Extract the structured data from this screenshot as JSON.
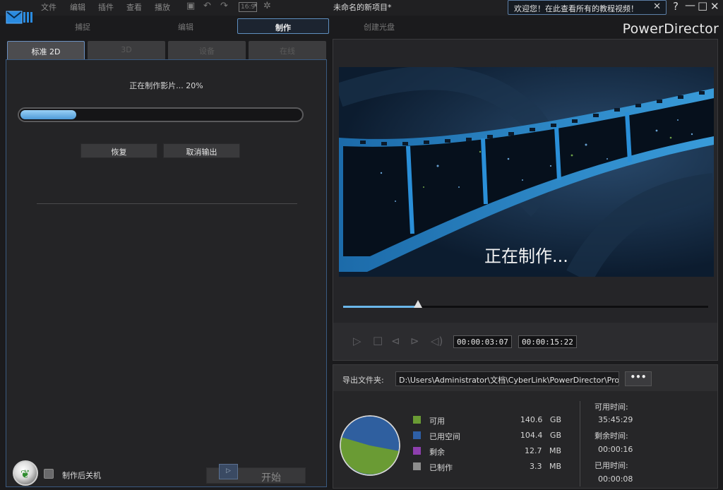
{
  "menu": {
    "file": "文件",
    "edit": "编辑",
    "plugins": "插件",
    "view": "查看",
    "playback": "播放"
  },
  "toolbar": {
    "aspect": "16:9"
  },
  "window_title": "未命名的新项目*",
  "welcome_tip": "欢迎您！在此查看所有的教程视频！",
  "window_controls": {
    "help": "?",
    "minimize": "—",
    "maximize": "□",
    "close": "✕"
  },
  "mode_tabs": {
    "capture": "捕捉",
    "edit": "编辑",
    "produce": "制作",
    "create_disc": "创建光盘"
  },
  "brand": "PowerDirector",
  "left_tabs": {
    "standard_2d": "标准 2D",
    "three_d": "3D",
    "device": "设备",
    "online": "在线"
  },
  "production": {
    "status": "正在制作影片... 20%",
    "progress_fraction": 0.2,
    "resume_label": "恢复",
    "cancel_label": "取消输出"
  },
  "footer": {
    "shutdown_label": "制作后关机",
    "start_label": "开始"
  },
  "preview": {
    "caption": "正在制作...",
    "seek_fraction": 0.205,
    "current_time": "00:00:03:07",
    "total_time": "00:00:15:22"
  },
  "output": {
    "folder_label": "导出文件夹:",
    "folder_path": "D:\\Users\\Administrator\\文档\\CyberLink\\PowerDirector\\Proc",
    "browse_label": "•••",
    "legend": [
      {
        "label": "可用",
        "value": "140.6",
        "unit": "GB",
        "color": "#6a9b34"
      },
      {
        "label": "已用空间",
        "value": "104.4",
        "unit": "GB",
        "color": "#2e5fa6"
      },
      {
        "label": "剩余",
        "value": "12.7",
        "unit": "MB",
        "color": "#8e3fae"
      },
      {
        "label": "已制作",
        "value": "3.3",
        "unit": "MB",
        "color": "#8d8d8d"
      }
    ],
    "available_time_label": "可用时间:",
    "available_time": "35:45:29",
    "remaining_time_label": "剩余时间:",
    "remaining_time": "00:00:16",
    "elapsed_time_label": "已用时间:",
    "elapsed_time": "00:00:08"
  }
}
